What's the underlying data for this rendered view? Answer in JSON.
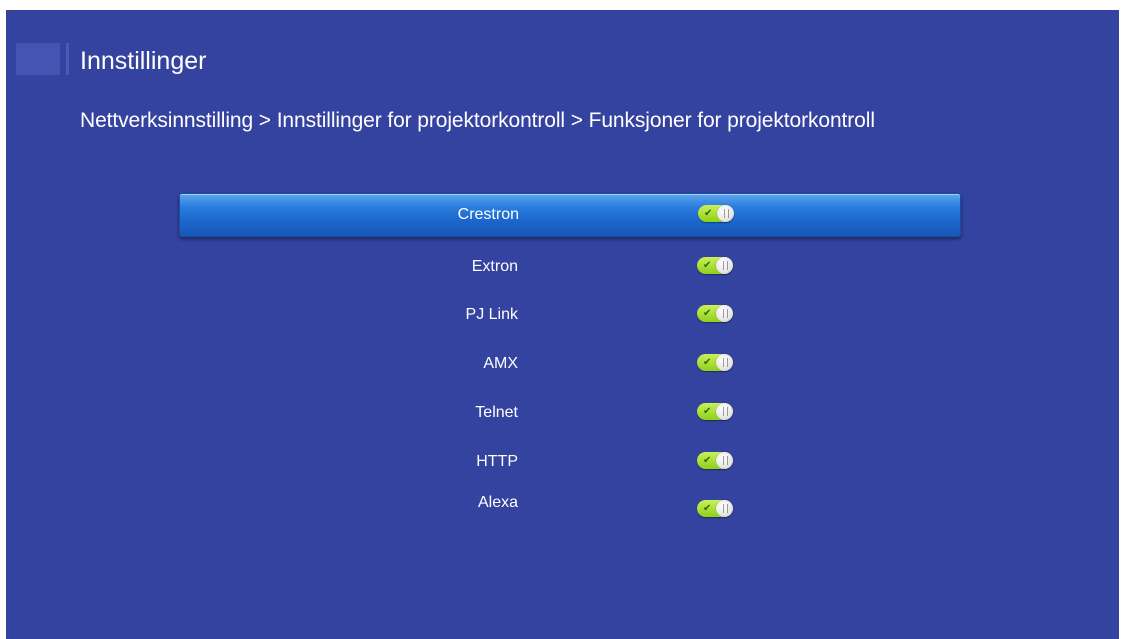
{
  "header": {
    "title": "Innstillinger",
    "breadcrumb": "Nettverksinnstilling > Innstillinger for projektorkontroll > Funksjoner for projektorkontroll"
  },
  "colors": {
    "background": "#3442a0",
    "selection": "#2a7ee0",
    "toggle_on": "#a6e02a"
  },
  "menu": {
    "selected_index": 0,
    "items": [
      {
        "label": "Crestron",
        "toggle_state": "on",
        "toggle_icon": "check-icon"
      },
      {
        "label": "Extron",
        "toggle_state": "on",
        "toggle_icon": "check-icon"
      },
      {
        "label": "PJ Link",
        "toggle_state": "on",
        "toggle_icon": "check-icon"
      },
      {
        "label": "AMX",
        "toggle_state": "on",
        "toggle_icon": "check-icon"
      },
      {
        "label": "Telnet",
        "toggle_state": "on",
        "toggle_icon": "check-icon"
      },
      {
        "label": "HTTP",
        "toggle_state": "on",
        "toggle_icon": "check-icon"
      },
      {
        "label": "Alexa",
        "toggle_state": "on",
        "toggle_icon": "check-icon"
      }
    ]
  }
}
